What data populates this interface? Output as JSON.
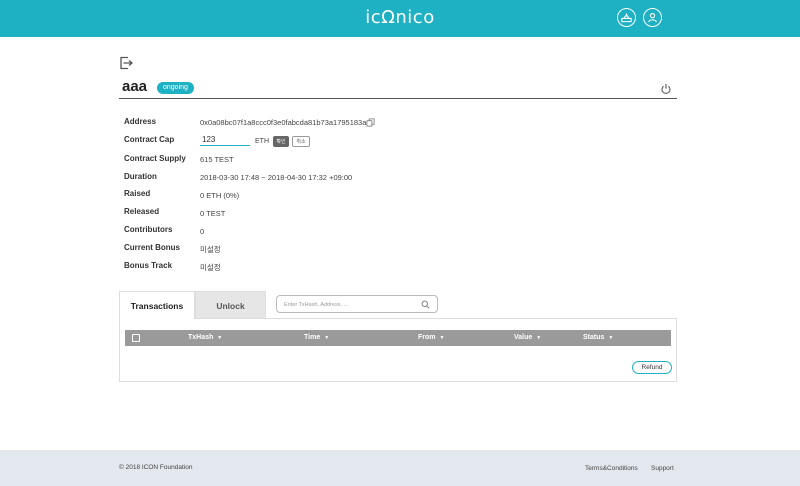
{
  "header": {
    "logo": "icΩnico",
    "icons": [
      "wallet-icon",
      "user-icon"
    ]
  },
  "page": {
    "title": "aaa",
    "status": "ongoing"
  },
  "info": {
    "address": {
      "label": "Address",
      "value": "0x0a08bc07f1a8ccc0f3e0fabcda81b73a1795183a"
    },
    "contract_cap": {
      "label": "Contract Cap",
      "value": "123",
      "unit": "ETH",
      "confirm_label": "확인",
      "cancel_label": "취소"
    },
    "contract_supply": {
      "label": "Contract Supply",
      "value": "615 TEST"
    },
    "duration": {
      "label": "Duration",
      "value": "2018-03-30 17:48 ~ 2018-04-30 17:32 +09:00"
    },
    "raised": {
      "label": "Raised",
      "value": "0 ETH (0%)"
    },
    "released": {
      "label": "Released",
      "value": "0 TEST"
    },
    "contributors": {
      "label": "Contributors",
      "value": "0"
    },
    "current_bonus": {
      "label": "Current Bonus",
      "value": "미설정"
    },
    "bonus_track": {
      "label": "Bonus Track",
      "value": "미설정"
    }
  },
  "tabs": {
    "transactions": "Transactions",
    "unlock": "Unlock",
    "active": "Transactions"
  },
  "search": {
    "placeholder": "Enter TxHash, Address, ..."
  },
  "table": {
    "columns": [
      "TxHash",
      "Time",
      "From",
      "Value",
      "Status"
    ],
    "sort_glyph": "▼",
    "rows": [],
    "refund_label": "Refund"
  },
  "footer": {
    "copyright": "© 2018 ICON Foundation",
    "terms": "Terms&Conditions",
    "support": "Support"
  },
  "colors": {
    "accent": "#1eb0c3",
    "table_header": "#9a9a9a",
    "footer_bg": "#e3e7ee"
  }
}
